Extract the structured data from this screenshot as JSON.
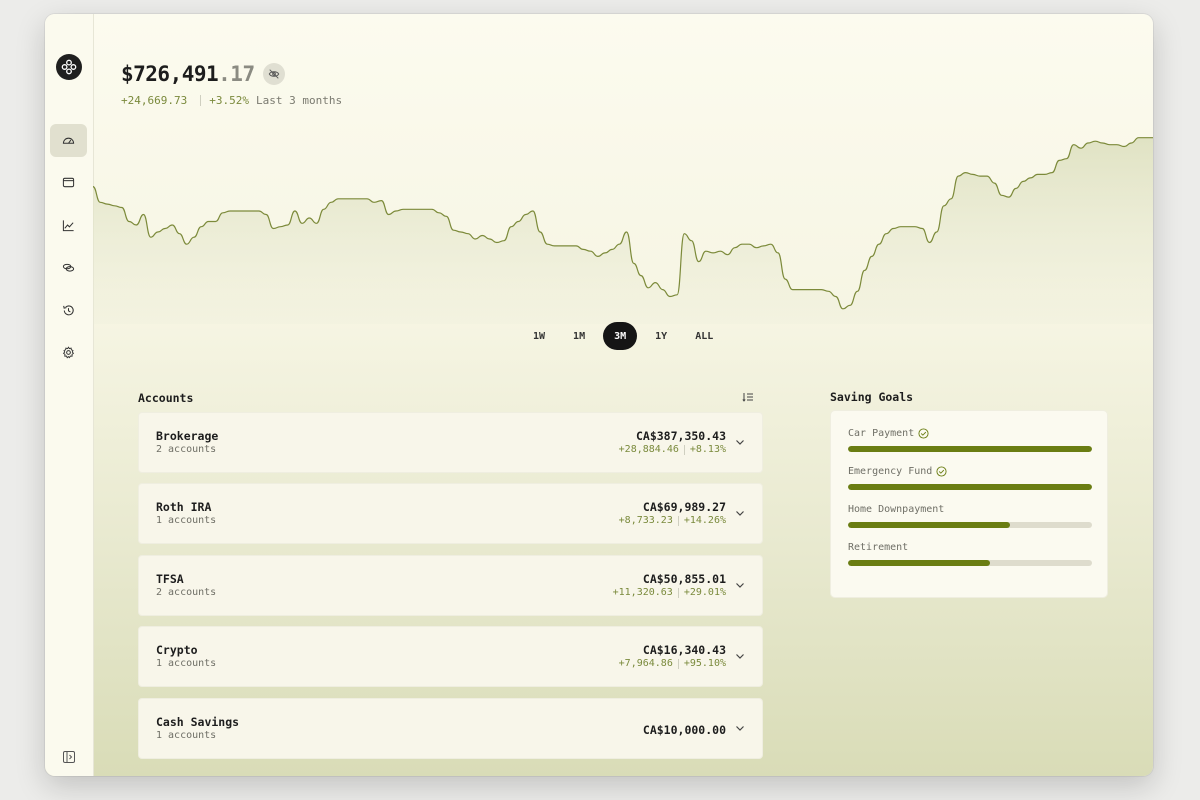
{
  "sidebar": {
    "items": [
      {
        "name": "dashboard",
        "icon": "gauge-icon",
        "active": true
      },
      {
        "name": "accounts",
        "icon": "wallet-icon",
        "active": false
      },
      {
        "name": "activity",
        "icon": "trend-chart-icon",
        "active": false
      },
      {
        "name": "holdings",
        "icon": "coins-icon",
        "active": false
      },
      {
        "name": "history",
        "icon": "history-icon",
        "active": false
      },
      {
        "name": "settings",
        "icon": "gear-icon",
        "active": false
      }
    ]
  },
  "header": {
    "balance_main": "$726,491",
    "balance_cents": ".17",
    "change_amount": "+24,669.73",
    "change_percent": "+3.52%",
    "period_label": "Last 3 months"
  },
  "chart_data": {
    "type": "area",
    "title": "",
    "xlabel": "",
    "ylabel": "",
    "series_color": "#7c8a3a",
    "values": [
      73,
      64,
      63,
      62,
      61,
      53,
      51,
      57,
      44,
      47,
      49,
      51,
      46,
      40,
      44,
      50,
      53,
      53,
      58,
      59,
      59,
      59,
      59,
      59,
      57,
      49,
      50,
      51,
      59,
      52,
      55,
      52,
      60,
      64,
      66,
      66,
      66,
      66,
      66,
      64,
      65,
      57,
      59,
      60,
      60,
      60,
      60,
      60,
      58,
      56,
      48,
      47,
      46,
      43,
      45,
      43,
      41,
      42,
      50,
      53,
      57,
      59,
      47,
      40,
      39,
      39,
      39,
      39,
      37,
      36,
      33,
      35,
      37,
      40,
      47,
      29,
      22,
      15,
      18,
      14,
      10,
      11,
      46,
      42,
      30,
      36,
      35,
      36,
      34,
      38,
      40,
      40,
      38,
      39,
      40,
      35,
      20,
      14,
      14,
      14,
      14,
      14,
      13,
      10,
      3,
      5,
      13,
      25,
      33,
      40,
      46,
      49,
      50,
      50,
      50,
      49,
      41,
      47,
      62,
      66,
      79,
      81,
      80,
      79,
      79,
      75,
      68,
      67,
      72,
      76,
      78,
      80,
      80,
      81,
      88,
      89,
      97,
      95,
      98,
      99,
      98,
      97,
      97,
      96,
      98,
      101,
      101,
      101
    ]
  },
  "ranges": {
    "items": [
      "1W",
      "1M",
      "3M",
      "1Y",
      "ALL"
    ],
    "active": "3M"
  },
  "accounts": {
    "title": "Accounts",
    "items": [
      {
        "name": "Brokerage",
        "count": "2 accounts",
        "amount": "CA$387,350.43",
        "change": "+28,884.46",
        "percent": "+8.13%"
      },
      {
        "name": "Roth IRA",
        "count": "1 accounts",
        "amount": "CA$69,989.27",
        "change": "+8,733.23",
        "percent": "+14.26%"
      },
      {
        "name": "TFSA",
        "count": "2 accounts",
        "amount": "CA$50,855.01",
        "change": "+11,320.63",
        "percent": "+29.01%"
      },
      {
        "name": "Crypto",
        "count": "1 accounts",
        "amount": "CA$16,340.43",
        "change": "+7,964.86",
        "percent": "+95.10%"
      },
      {
        "name": "Cash Savings",
        "count": "1 accounts",
        "amount": "CA$10,000.00"
      }
    ]
  },
  "goals": {
    "title": "Saving Goals",
    "items": [
      {
        "label": "Car Payment",
        "progress": 1.0,
        "completed": true
      },
      {
        "label": "Emergency Fund",
        "progress": 1.0,
        "completed": true
      },
      {
        "label": "Home Downpayment",
        "progress": 0.665,
        "completed": false
      },
      {
        "label": "Retirement",
        "progress": 0.58,
        "completed": false
      }
    ]
  },
  "colors": {
    "accent": "#6a7d12",
    "positive": "#7a8a3c",
    "active_range": "#151515"
  }
}
